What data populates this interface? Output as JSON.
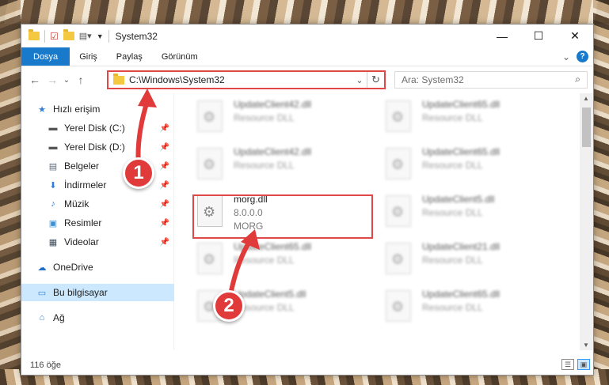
{
  "window": {
    "title": "System32",
    "controls": {
      "minimize": "—",
      "maximize": "☐",
      "close": "✕"
    }
  },
  "ribbon": {
    "tabs": [
      "Dosya",
      "Giriş",
      "Paylaş",
      "Görünüm"
    ],
    "expand_glyph": "⌄",
    "help_glyph": "?",
    "accent": "#1979ca"
  },
  "nav": {
    "back": "←",
    "forward": "→",
    "recent": "⌄",
    "up": "↑"
  },
  "address": {
    "path": "C:\\Windows\\System32",
    "dropdown": "⌄",
    "refresh": "↻"
  },
  "search": {
    "placeholder": "Ara: System32",
    "icon": "⌕"
  },
  "sidebar": {
    "items": [
      {
        "label": "Hızlı erişim",
        "icon": "★",
        "pinned": false
      },
      {
        "label": "Yerel Disk (C:)",
        "icon": "▬",
        "pinned": true
      },
      {
        "label": "Yerel Disk (D:)",
        "icon": "▬",
        "pinned": true
      },
      {
        "label": "Belgeler",
        "icon": "▤",
        "pinned": true
      },
      {
        "label": "İndirmeler",
        "icon": "⬇",
        "pinned": true
      },
      {
        "label": "Müzik",
        "icon": "♪",
        "pinned": true
      },
      {
        "label": "Resimler",
        "icon": "▣",
        "pinned": true
      },
      {
        "label": "Videolar",
        "icon": "▦",
        "pinned": true
      },
      {
        "label": "OneDrive",
        "icon": "☁",
        "pinned": false
      },
      {
        "label": "Bu bilgisayar",
        "icon": "▭",
        "pinned": false,
        "selected": true
      },
      {
        "label": "Ağ",
        "icon": "⌂",
        "pinned": false
      }
    ],
    "pin_glyph": "📌"
  },
  "files": {
    "col1": [
      {
        "name": "UpdateClient42.dll",
        "sub": "Resource DLL"
      },
      {
        "name": "UpdateClient42.dll",
        "sub": "Resource DLL"
      },
      {
        "name": "morg.dll",
        "version": "8.0.0.0",
        "sub": "MORG"
      },
      {
        "name": "UpdateClient65.dll",
        "sub": "Resource DLL"
      },
      {
        "name": "UpdateClient5.dll",
        "sub": "Resource DLL"
      }
    ],
    "col2": [
      {
        "name": "UpdateClient65.dll",
        "sub": "Resource DLL"
      },
      {
        "name": "UpdateClient65.dll",
        "sub": "Resource DLL"
      },
      {
        "name": "UpdateClient5.dll",
        "sub": "Resource DLL"
      },
      {
        "name": "UpdateClient21.dll",
        "sub": "Resource DLL"
      },
      {
        "name": "UpdateClient65.dll",
        "sub": "Resource DLL"
      }
    ]
  },
  "status": {
    "count": "116 öğe"
  },
  "annotations": {
    "step1": "1",
    "step2": "2",
    "color": "#e03a3a"
  }
}
